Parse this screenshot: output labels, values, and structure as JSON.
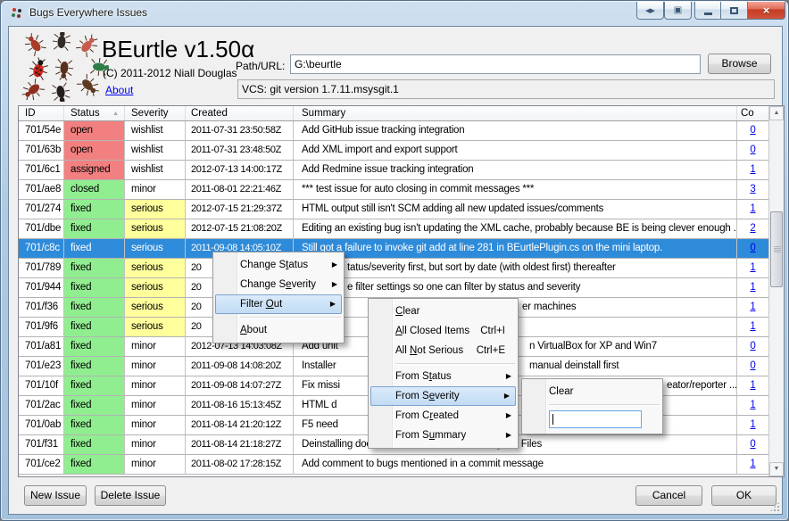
{
  "window": {
    "title": "Bugs Everywhere Issues"
  },
  "header": {
    "app_title": "BEurtle v1.50α",
    "copyright": "(C) 2011-2012 Niall Douglas",
    "about": "About",
    "path_label": "Path/URL:",
    "path_value": "G:\\beurtle",
    "browse": "Browse",
    "vcs": "VCS: git version 1.7.11.msysgit.1"
  },
  "table": {
    "columns": {
      "id": "ID",
      "status": "Status",
      "severity": "Severity",
      "created": "Created",
      "summary": "Summary",
      "comments": "Co"
    },
    "rows": [
      {
        "id": "701/54e",
        "status": "open",
        "severity": "wishlist",
        "created": "2011-07-31 23:50:58Z",
        "summary": "Add GitHub issue tracking integration",
        "summary_right": "",
        "comments": "0"
      },
      {
        "id": "701/63b",
        "status": "open",
        "severity": "wishlist",
        "created": "2011-07-31 23:48:50Z",
        "summary": "Add XML import and export support",
        "summary_right": "",
        "comments": "0"
      },
      {
        "id": "701/6c1",
        "status": "assigned",
        "severity": "wishlist",
        "created": "2012-07-13 14:00:17Z",
        "summary": "Add Redmine issue tracking integration",
        "summary_right": "",
        "comments": "1"
      },
      {
        "id": "701/ae8",
        "status": "closed",
        "severity": "minor",
        "created": "2011-08-01 22:21:46Z",
        "summary": "*** test issue for auto closing in commit messages ***",
        "summary_right": "",
        "comments": "3"
      },
      {
        "id": "701/274",
        "status": "fixed",
        "severity": "serious",
        "created": "2012-07-15 21:29:37Z",
        "summary": "HTML output still isn't SCM adding all new updated issues/comments",
        "summary_right": "",
        "comments": "1"
      },
      {
        "id": "701/dbe",
        "status": "fixed",
        "severity": "serious",
        "created": "2012-07-15 21:08:20Z",
        "summary": "Editing an existing bug isn't updating the XML cache, probably because BE is being clever enough ...",
        "summary_right": "",
        "comments": "2"
      },
      {
        "id": "701/c8c",
        "status": "fixed",
        "severity": "serious",
        "created": "2011-09-08 14:05:10Z",
        "summary": "Still got a failure to invoke git add at line 281 in BEurtlePlugin.cs on the mini laptop.",
        "summary_right": "",
        "comments": "0",
        "selected": true
      },
      {
        "id": "701/789",
        "status": "fixed",
        "severity": "serious",
        "created": "20",
        "summary": "",
        "summary_right": "tatus/severity first, but sort by date (with oldest first) thereafter",
        "comments": "1"
      },
      {
        "id": "701/944",
        "status": "fixed",
        "severity": "serious",
        "created": "20",
        "summary": "",
        "summary_right": "e filter settings so one can filter by status and severity",
        "comments": "1"
      },
      {
        "id": "701/f36",
        "status": "fixed",
        "severity": "serious",
        "created": "20",
        "summary": "",
        "summary_right": "er machines",
        "comments": "1"
      },
      {
        "id": "701/9f6",
        "status": "fixed",
        "severity": "serious",
        "created": "20",
        "summary": "",
        "summary_right": "",
        "comments": "1"
      },
      {
        "id": "701/a81",
        "status": "fixed",
        "severity": "minor",
        "created": "2012-07-13 14:03:08Z",
        "summary": "Add unit",
        "summary_right": "n VirtualBox for XP and Win7",
        "comments": "0"
      },
      {
        "id": "701/e23",
        "status": "fixed",
        "severity": "minor",
        "created": "2011-09-08 14:08:20Z",
        "summary": "Installer",
        "summary_right": "manual deinstall first",
        "comments": "0"
      },
      {
        "id": "701/10f",
        "status": "fixed",
        "severity": "minor",
        "created": "2011-09-08 14:07:27Z",
        "summary": "Fix missi",
        "summary_right": "eator/reporter ...",
        "comments": "1"
      },
      {
        "id": "701/2ac",
        "status": "fixed",
        "severity": "minor",
        "created": "2011-08-16 15:13:45Z",
        "summary": "HTML d",
        "summary_right": "",
        "comments": "1"
      },
      {
        "id": "701/0ab",
        "status": "fixed",
        "severity": "minor",
        "created": "2011-08-14 21:20:12Z",
        "summary": "F5 need",
        "summary_right": "",
        "comments": "1"
      },
      {
        "id": "701/f31",
        "status": "fixed",
        "severity": "minor",
        "created": "2011-08-14 21:18:27Z",
        "summary": "Deinstalling doesn't remove all files from Program Files",
        "summary_right": "",
        "comments": "0"
      },
      {
        "id": "701/ce2",
        "status": "fixed",
        "severity": "minor",
        "created": "2011-08-02 17:28:15Z",
        "summary": "Add comment to bugs mentioned in a commit message",
        "summary_right": "",
        "comments": "1"
      }
    ]
  },
  "menus": {
    "context": {
      "items": [
        {
          "pre": "Change S",
          "key": "t",
          "post": "atus",
          "arrow": true
        },
        {
          "pre": "Change S",
          "key": "e",
          "post": "verity",
          "arrow": true
        },
        {
          "pre": "Filter ",
          "key": "O",
          "post": "ut",
          "arrow": true,
          "highlight": true
        },
        {
          "separator": true
        },
        {
          "pre": "",
          "key": "A",
          "post": "bout"
        }
      ]
    },
    "filter_out": {
      "items": [
        {
          "pre": "",
          "key": "C",
          "post": "lear"
        },
        {
          "pre": "",
          "key": "A",
          "post": "ll Closed Items",
          "shortcut": "Ctrl+I"
        },
        {
          "pre": "All ",
          "key": "N",
          "post": "ot Serious",
          "shortcut": "Ctrl+E"
        },
        {
          "separator": true
        },
        {
          "pre": "From S",
          "key": "t",
          "post": "atus",
          "arrow": true
        },
        {
          "pre": "From S",
          "key": "e",
          "post": "verity",
          "arrow": true,
          "highlight": true
        },
        {
          "pre": "From C",
          "key": "r",
          "post": "eated",
          "arrow": true
        },
        {
          "pre": "From S",
          "key": "u",
          "post": "mmary",
          "arrow": true
        }
      ]
    },
    "severity_filter": {
      "clear": "Clear",
      "filter_value": ""
    }
  },
  "footer": {
    "new_issue": "New Issue",
    "delete_issue": "Delete Issue",
    "cancel": "Cancel",
    "ok": "OK"
  },
  "colors": {
    "link": "#0000EE",
    "selected_row": "#2E8BD9",
    "status_open": "#F28080",
    "status_closed": "#90EE90",
    "severity_serious": "#FFFF9C",
    "severity_normal": "#FFFFFF"
  }
}
